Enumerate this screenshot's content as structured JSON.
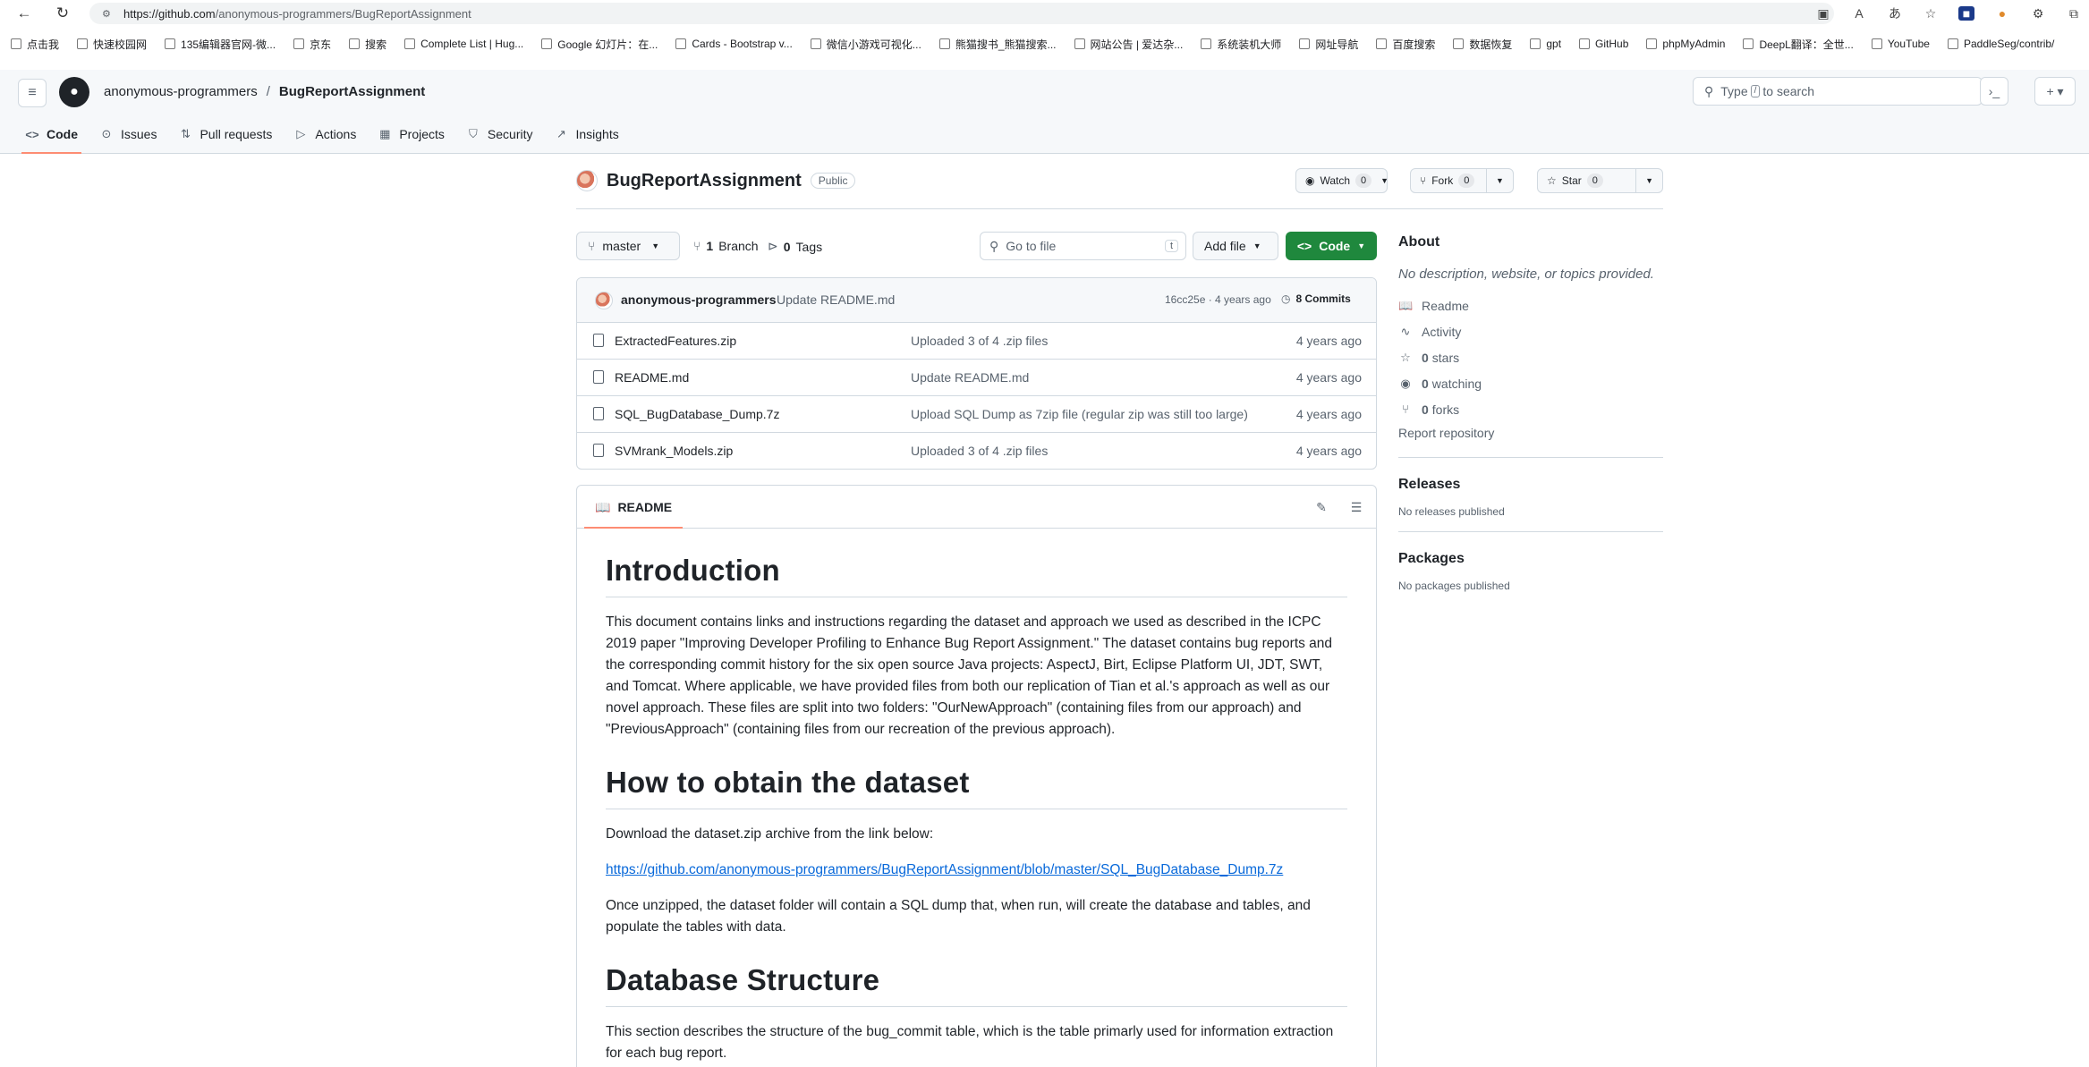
{
  "browser": {
    "url_host": "https://github.com",
    "url_path": "/anonymous-programmers/BugReportAssignment",
    "bookmarks": [
      "点击我",
      "快速校园网",
      "135编辑器官网-微...",
      "京东",
      "搜索",
      "Complete List | Hug...",
      "Google 幻灯片：在...",
      "Cards - Bootstrap v...",
      "微信小游戏可视化...",
      "熊猫搜书_熊猫搜索...",
      "网站公告 | 爱达杂...",
      "系统装机大师",
      "网址导航",
      "百度搜索",
      "数据恢复",
      "gpt",
      "GitHub",
      "phpMyAdmin",
      "DeepL翻译：全世...",
      "YouTube",
      "PaddleSeg/contrib/"
    ]
  },
  "header": {
    "owner": "anonymous-programmers",
    "separator": "/",
    "repo": "BugReportAssignment",
    "search_prefix": "Type",
    "search_key": "/",
    "search_suffix": "to search"
  },
  "repo_nav": [
    {
      "label": "Code",
      "icon": "code-icon",
      "glyph": "<>"
    },
    {
      "label": "Issues",
      "icon": "issue-icon",
      "glyph": "⊙"
    },
    {
      "label": "Pull requests",
      "icon": "pull-request-icon",
      "glyph": "⇅"
    },
    {
      "label": "Actions",
      "icon": "play-icon",
      "glyph": "▷"
    },
    {
      "label": "Projects",
      "icon": "table-icon",
      "glyph": "▦"
    },
    {
      "label": "Security",
      "icon": "shield-icon",
      "glyph": "⛉"
    },
    {
      "label": "Insights",
      "icon": "graph-icon",
      "glyph": "↗"
    }
  ],
  "repo": {
    "name": "BugReportAssignment",
    "visibility": "Public",
    "watch_label": "Watch",
    "watch_count": "0",
    "fork_label": "Fork",
    "fork_count": "0",
    "star_label": "Star",
    "star_count": "0"
  },
  "branch_bar": {
    "branch": "master",
    "branches_count": "1",
    "branches_label": "Branch",
    "tags_count": "0",
    "tags_label": "Tags",
    "goto_placeholder": "Go to file",
    "goto_key": "t",
    "add_file": "Add file",
    "code": "Code"
  },
  "latest_commit": {
    "author": "anonymous-programmers",
    "message": "Update README.md",
    "meta": "16cc25e · 4 years ago",
    "commits": "8 Commits"
  },
  "files": [
    {
      "name": "ExtractedFeatures.zip",
      "message": "Uploaded 3 of 4 .zip files",
      "date": "4 years ago"
    },
    {
      "name": "README.md",
      "message": "Update README.md",
      "date": "4 years ago"
    },
    {
      "name": "SQL_BugDatabase_Dump.7z",
      "message": "Upload SQL Dump as 7zip file (regular zip was still too large)",
      "date": "4 years ago"
    },
    {
      "name": "SVMrank_Models.zip",
      "message": "Uploaded 3 of 4 .zip files",
      "date": "4 years ago"
    }
  ],
  "readme": {
    "tab": "README",
    "h_intro": "Introduction",
    "p_intro": "This document contains links and instructions regarding the dataset and approach we used as described in the ICPC 2019 paper \"Improving Developer Profiling to Enhance Bug Report Assignment.\" The dataset contains bug reports and the corresponding commit history for the six open source Java projects: AspectJ, Birt, Eclipse Platform UI, JDT, SWT, and Tomcat. Where applicable, we have provided files from both our replication of Tian et al.'s approach as well as our novel approach. These files are split into two folders: \"OurNewApproach\" (containing files from our approach) and \"PreviousApproach\" (containing files from our recreation of the previous approach).",
    "h_obtain": "How to obtain the dataset",
    "p_download": "Download the dataset.zip archive from the link below:",
    "link": "https://github.com/anonymous-programmers/BugReportAssignment/blob/master/SQL_BugDatabase_Dump.7z",
    "p_unzip": "Once unzipped, the dataset folder will contain a SQL dump that, when run, will create the database and tables, and populate the tables with data.",
    "h_db": "Database Structure",
    "p_db": "This section describes the structure of the bug_commit table, which is the table primarly used for information extraction for each bug report."
  },
  "sidebar": {
    "about": "About",
    "description": "No description, website, or topics provided.",
    "items": [
      {
        "icon": "book-icon",
        "glyph": "📖",
        "count": "",
        "label": "Readme"
      },
      {
        "icon": "pulse-icon",
        "glyph": "∿",
        "count": "",
        "label": "Activity"
      },
      {
        "icon": "star-icon",
        "glyph": "☆",
        "count": "0",
        "label": "stars"
      },
      {
        "icon": "eye-icon",
        "glyph": "◉",
        "count": "0",
        "label": "watching"
      },
      {
        "icon": "fork-icon",
        "glyph": "⑂",
        "count": "0",
        "label": "forks"
      }
    ],
    "report": "Report repository",
    "releases": "Releases",
    "no_releases": "No releases published",
    "packages": "Packages",
    "no_packages": "No packages published"
  }
}
